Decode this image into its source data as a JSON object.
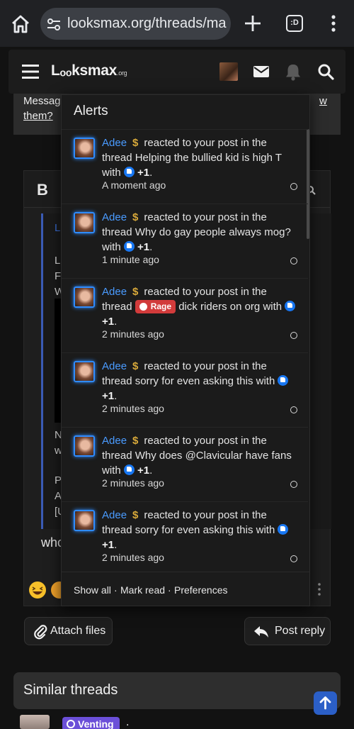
{
  "browser": {
    "url": "looksmax.org/threads/mas",
    "tab_count": ":D"
  },
  "header": {
    "logo_main": "Lₒₒksmax",
    "logo_suffix": ".org"
  },
  "background": {
    "banner_line1": "Messag",
    "banner_line2": "them?",
    "banner_link_right": "w",
    "bold_button": "B",
    "quote_link": "Lo",
    "quote_lines": [
      "Li",
      "Fu",
      "W",
      "N",
      "w",
      "Pl",
      "Ar",
      "[U"
    ],
    "reply_text": "who",
    "attach_files": "Attach files",
    "post_reply": "Post reply",
    "similar_threads": "Similar threads",
    "venting_tag": "Venting",
    "venting_after": "."
  },
  "alerts": {
    "title": "Alerts",
    "items": [
      {
        "user": "Adee",
        "pre": "reacted to your post in the thread ",
        "thread": "Helping the bullied kid is high T",
        "with": " with ",
        "plus": "+1",
        "tail": ".",
        "time": "A moment ago"
      },
      {
        "user": "Adee",
        "pre": "reacted to your post in the thread ",
        "thread": "Why do gay people always mog?",
        "with": " with ",
        "plus": "+1",
        "tail": ".",
        "time": "1 minute ago"
      },
      {
        "user": "Adee",
        "pre": "reacted to your post in the thread ",
        "tag": "Rage",
        "thread": "dick riders on org",
        "with": " with ",
        "plus": "+1",
        "tail": ".",
        "time": "2 minutes ago"
      },
      {
        "user": "Adee",
        "pre": "reacted to your post in the thread ",
        "thread": "sorry for even asking this",
        "with": " with ",
        "plus": "+1",
        "tail": ".",
        "time": "2 minutes ago"
      },
      {
        "user": "Adee",
        "pre": "reacted to your post in the thread ",
        "thread": "Why does @Clavicular have fans",
        "with": " with ",
        "plus": "+1",
        "tail": ".",
        "time": "2 minutes ago"
      },
      {
        "user": "Adee",
        "pre": "reacted to your post in the thread ",
        "thread": "sorry for even asking this",
        "with": " with ",
        "plus": "+1",
        "tail": ".",
        "time": "2 minutes ago"
      }
    ],
    "footer": {
      "show_all": "Show all",
      "sep1": "·",
      "mark_read": "Mark read",
      "sep2": "·",
      "preferences": "Preferences"
    }
  }
}
